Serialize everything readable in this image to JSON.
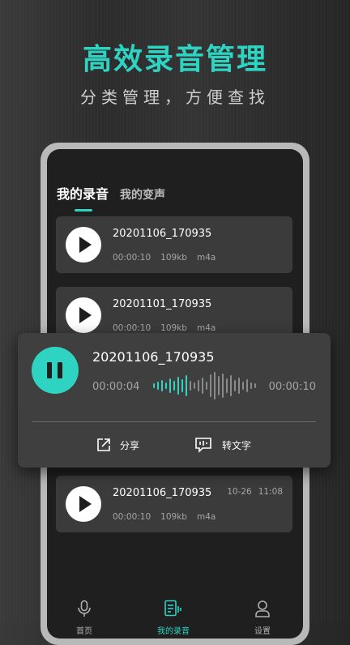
{
  "promo": {
    "headline": "高效录音管理",
    "subline": "分类管理，方便查找"
  },
  "tabs": [
    {
      "label": "我的录音"
    },
    {
      "label": "我的变声"
    }
  ],
  "recordings": [
    {
      "name": "20201106_170935",
      "duration": "00:00:10",
      "size": "109kb",
      "format": "m4a"
    },
    {
      "name": "20201101_170935",
      "duration": "00:00:10",
      "size": "109kb",
      "format": "m4a"
    },
    {
      "name": "20201106_170935",
      "duration": "00:00:10",
      "size": "109kb",
      "format": "m4a",
      "date": "10-26",
      "time": "11:08"
    }
  ],
  "player": {
    "title": "20201106_170935",
    "current_time": "00:00:04",
    "total_time": "00:00:10",
    "share_label": "分享",
    "transcribe_label": "转文字"
  },
  "nav": [
    {
      "label": "首页",
      "icon": "microphone-icon"
    },
    {
      "label": "我的录音",
      "icon": "recordings-icon"
    },
    {
      "label": "设置",
      "icon": "person-icon"
    }
  ],
  "colors": {
    "accent": "#2ed3c2",
    "card": "#3b3b3b",
    "screen": "#1f1f1f"
  }
}
